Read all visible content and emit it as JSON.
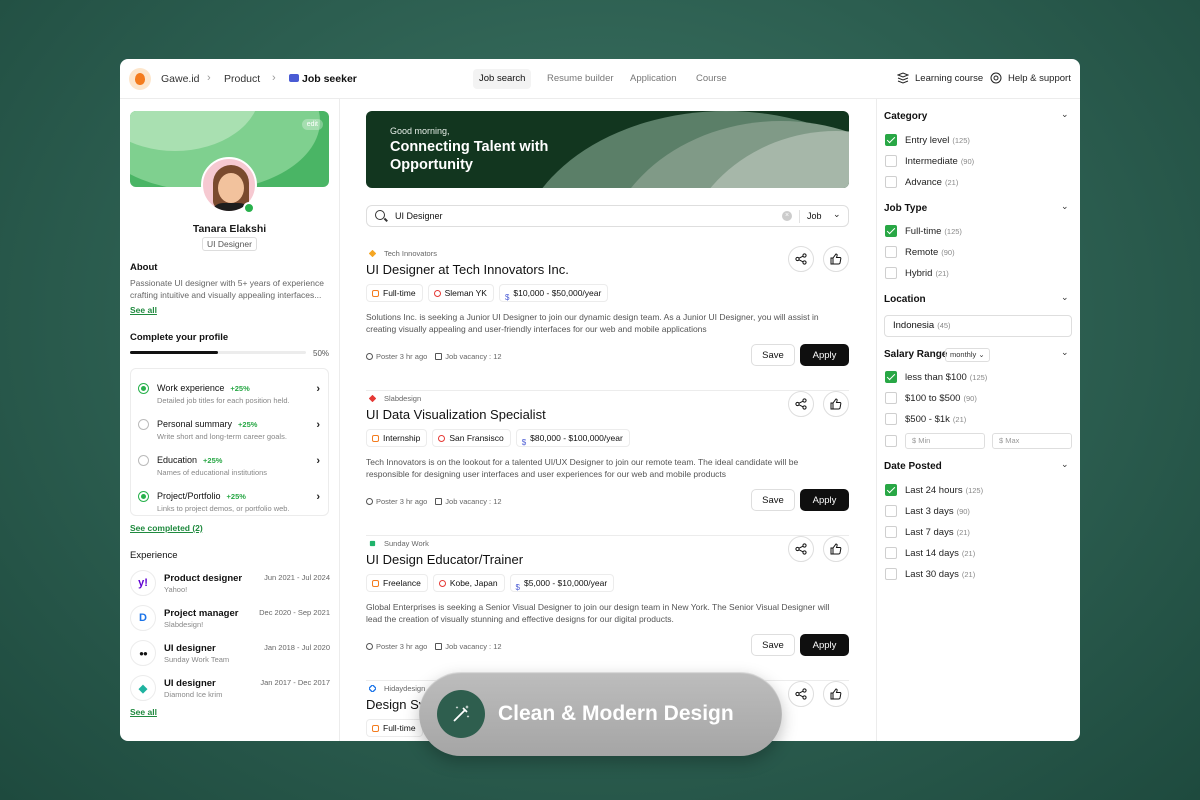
{
  "nav": {
    "brand": "Gawe.id",
    "breadcrumb": [
      "Product",
      "Job seeker"
    ],
    "tabs": [
      "Job search",
      "Resume builder",
      "Application",
      "Course"
    ],
    "active_tab": "Job search",
    "right": [
      "Learning course",
      "Help & support"
    ]
  },
  "profile": {
    "edit": "edit",
    "name": "Tanara Elakshi",
    "role": "UI Designer",
    "about_title": "About",
    "about_text": "Passionate UI designer with 5+ years of experience crafting intuitive and visually appealing interfaces...",
    "see_all": "See all",
    "complete_title": "Complete your profile",
    "progress": 0.5,
    "progress_label": "50%",
    "tasks": [
      {
        "title": "Work experience",
        "pct": "+25%",
        "desc": "Detailed job titles for each position held.",
        "done": true
      },
      {
        "title": "Personal summary",
        "pct": "+25%",
        "desc": "Write short and long-term career goals.",
        "done": false
      },
      {
        "title": "Education",
        "pct": "+25%",
        "desc": "Names of educational institutions",
        "done": false
      },
      {
        "title": "Project/Portfolio",
        "pct": "+25%",
        "desc": "Links to project demos, or portfolio web.",
        "done": true
      }
    ],
    "see_completed": "See completed (2)",
    "experience_title": "Experience",
    "experience": [
      {
        "role": "Product designer",
        "company": "Yahoo!",
        "dates": "Jun 2021 - Jul 2024",
        "icon": "yahoo-icon",
        "glyph": "y!",
        "color": "#5f01d1"
      },
      {
        "role": "Project manager",
        "company": "Slabdesign!",
        "dates": "Dec 2020 - Sep 2021",
        "icon": "slabdesign-icon",
        "glyph": "D",
        "color": "#1a73e8"
      },
      {
        "role": "UI designer",
        "company": "Sunday Work Team",
        "dates": "Jan 2018 - Jul 2020",
        "icon": "medium-icon",
        "glyph": "●●",
        "color": "#111111"
      },
      {
        "role": "UI designer",
        "company": "Diamond Ice krim",
        "dates": "Jan 2017 - Dec 2017",
        "icon": "diamond-icon",
        "glyph": "◆",
        "color": "#1fb3a0"
      }
    ],
    "see_all_exp": "See all"
  },
  "banner": {
    "greeting": "Good morning,",
    "headline": "Connecting Talent with Opportunity"
  },
  "search": {
    "value": "UI Designer",
    "type": "Job"
  },
  "jobs": [
    {
      "company": "Tech Innovators",
      "company_color": "#f5a623",
      "title": "UI Designer at Tech Innovators Inc.",
      "type": "Full-time",
      "location": "Sleman YK",
      "salary": "$10,000 - $50,000/year",
      "desc": "Solutions Inc. is seeking a Junior UI Designer to join our dynamic design team. As a Junior UI Designer, you will assist in creating visually appealing and user-friendly interfaces for our web and mobile applications",
      "posted": "Poster 3 hr ago",
      "vacancy": "Job vacancy : 12"
    },
    {
      "company": "Slabdesign",
      "company_color": "#e53935",
      "title": "UI Data Visualization Specialist",
      "type": "Internship",
      "location": "San Fransisco",
      "salary": "$80,000 - $100,000/year",
      "desc": "Tech Innovators is on the lookout for a talented UI/UX Designer to join our remote team. The ideal candidate will be responsible for designing user interfaces and user experiences for our web and mobile products",
      "posted": "Poster 3 hr ago",
      "vacancy": "Job vacancy : 12"
    },
    {
      "company": "Sunday Work",
      "company_color": "#1fb36b",
      "title": "UI Design Educator/Trainer",
      "type": "Freelance",
      "location": "Kobe, Japan",
      "salary": "$5,000 - $10,000/year",
      "desc": "Global Enterprises is seeking a Senior Visual Designer to join our design team in New York. The Senior Visual Designer will lead the creation of visually stunning and effective designs for our digital products.",
      "posted": "Poster 3 hr ago",
      "vacancy": "Job vacancy : 12"
    },
    {
      "company": "Hidaydesign",
      "company_color": "#1a73e8",
      "title": "Design Sy",
      "type": "Full-time",
      "location": "",
      "salary": "",
      "desc": "",
      "posted": "",
      "vacancy": ""
    }
  ],
  "buttons": {
    "save": "Save",
    "apply": "Apply"
  },
  "toast": {
    "label": "Clean & Modern Design"
  },
  "filters": {
    "category": {
      "title": "Category",
      "options": [
        {
          "label": "Entry level",
          "count": "(125)",
          "checked": true
        },
        {
          "label": "Intermediate",
          "count": "(90)",
          "checked": false
        },
        {
          "label": "Advance",
          "count": "(21)",
          "checked": false
        }
      ]
    },
    "job_type": {
      "title": "Job Type",
      "options": [
        {
          "label": "Full-time",
          "count": "(125)",
          "checked": true
        },
        {
          "label": "Remote",
          "count": "(90)",
          "checked": false
        },
        {
          "label": "Hybrid",
          "count": "(21)",
          "checked": false
        }
      ]
    },
    "location": {
      "title": "Location",
      "value": "Indonesia",
      "count": "(45)"
    },
    "salary": {
      "title": "Salary Range",
      "period": "monthly",
      "options": [
        {
          "label": "less than $100",
          "count": "(125)",
          "checked": true
        },
        {
          "label": "$100 to $500",
          "count": "(90)",
          "checked": false
        },
        {
          "label": "$500 - $1k",
          "count": "(21)",
          "checked": false
        }
      ],
      "min": "Min",
      "max": "Max"
    },
    "date": {
      "title": "Date Posted",
      "options": [
        {
          "label": "Last 24 hours",
          "count": "(125)",
          "checked": true
        },
        {
          "label": "Last 3 days",
          "count": "(90)",
          "checked": false
        },
        {
          "label": "Last 7 days",
          "count": "(21)",
          "checked": false
        },
        {
          "label": "Last 14 days",
          "count": "(21)",
          "checked": false
        },
        {
          "label": "Last 30 days",
          "count": "(21)",
          "checked": false
        }
      ]
    }
  }
}
